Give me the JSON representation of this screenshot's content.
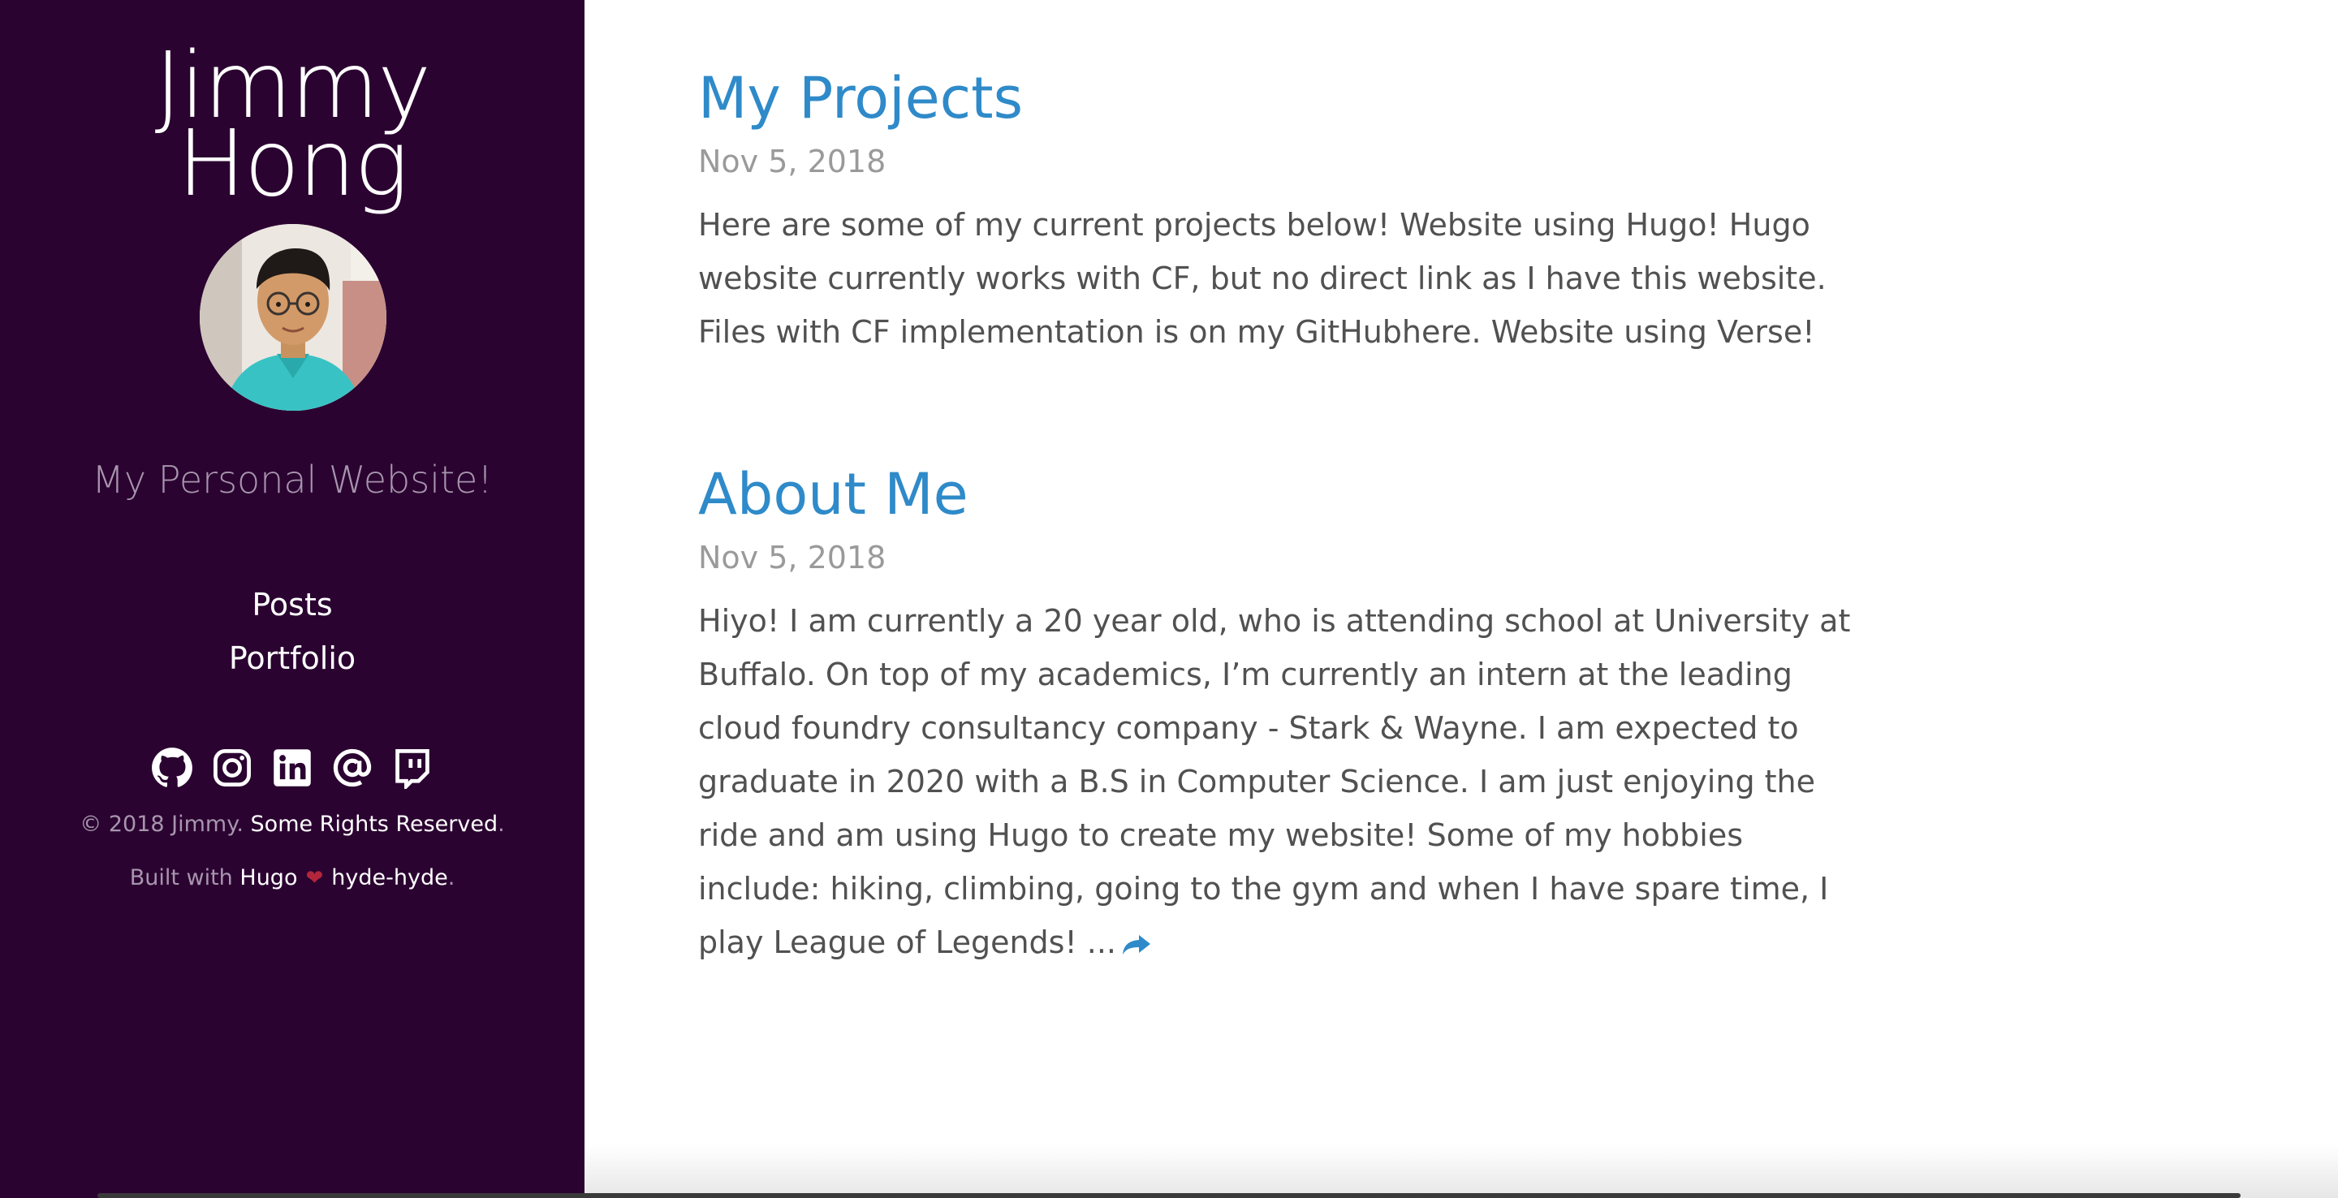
{
  "sidebar": {
    "title_line1": "Jimmy",
    "title_line2": "Hong",
    "tagline": "My Personal Website!",
    "nav": [
      {
        "label": "Posts"
      },
      {
        "label": "Portfolio"
      }
    ],
    "social_icons": [
      "github-icon",
      "instagram-icon",
      "linkedin-icon",
      "email-icon",
      "twitch-icon"
    ],
    "copyright_prefix": "© 2018 Jimmy. ",
    "copyright_link": "Some Rights Reserved",
    "copyright_suffix": ".",
    "built_prefix": "Built with ",
    "built_hugo": "Hugo",
    "built_heart": "❤",
    "built_theme": "hyde-hyde",
    "built_suffix": "."
  },
  "posts": [
    {
      "title": "My Projects",
      "date": "Nov 5, 2018",
      "summary": "Here are some of my current projects below! Website using Hugo! Hugo website currently works with CF, but no direct link as I have this website. Files with CF implementation is on my GitHubhere. Website using Verse!"
    },
    {
      "title": "About Me",
      "date": "Nov 5, 2018",
      "summary": "Hiyo! I am currently a 20 year old, who is attending school at University at Buffalo. On top of my academics, I’m currently an intern at the leading cloud foundry consultancy company - Stark & Wayne. I am expected to graduate in 2020 with a B.S in Computer Science. I am just enjoying the ride and am using Hugo to create my website! Some of my hobbies include: hiking, climbing, going to the gym and when I have spare time, I play League of Legends! ..."
    }
  ],
  "colors": {
    "sidebar_bg": "#2b0331",
    "link": "#2f8ac9",
    "muted": "#a796ad",
    "body_text": "#515151",
    "date": "#9a9a9a"
  }
}
